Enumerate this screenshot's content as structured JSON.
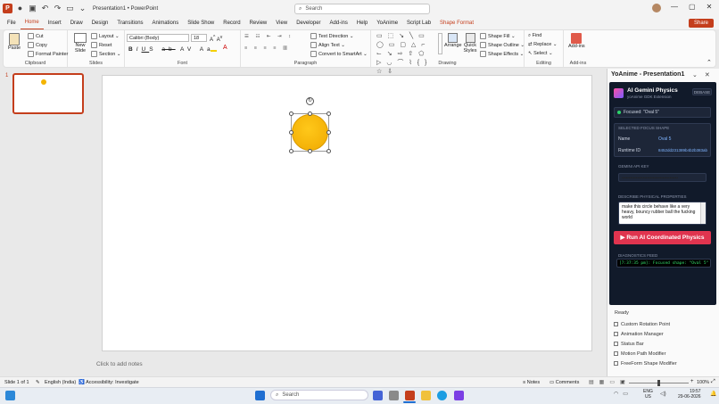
{
  "app": {
    "title": "Presentation1  •  PowerPoint",
    "search_placeholder": "Search",
    "share_label": "Share"
  },
  "tabs": [
    "File",
    "Home",
    "Insert",
    "Draw",
    "Design",
    "Transitions",
    "Animations",
    "Slide Show",
    "Record",
    "Review",
    "View",
    "Developer",
    "Add-ins",
    "Help",
    "YoAnime",
    "Script Lab",
    "Shape Format"
  ],
  "ribbon": {
    "clipboard": {
      "label": "Clipboard",
      "paste": "Paste",
      "cut": "Cut",
      "copy": "Copy",
      "format_painter": "Format Painter"
    },
    "slides": {
      "label": "Slides",
      "new_slide": "New Slide",
      "layout": "Layout",
      "reset": "Reset",
      "section": "Section"
    },
    "font": {
      "label": "Font",
      "font_name": "Calibri (Body)",
      "font_size": "18"
    },
    "paragraph": {
      "label": "Paragraph",
      "text_direction": "Text Direction",
      "align_text": "Align Text",
      "convert_smartart": "Convert to SmartArt"
    },
    "drawing": {
      "label": "Drawing",
      "arrange": "Arrange",
      "quick_styles": "Quick Styles",
      "shape_fill": "Shape Fill",
      "shape_outline": "Shape Outline",
      "shape_effects": "Shape Effects"
    },
    "editing": {
      "label": "Editing",
      "find": "Find",
      "replace": "Replace",
      "select": "Select"
    },
    "addins": {
      "label": "Add-ins",
      "addins_btn": "Add-ins"
    }
  },
  "slides": {
    "thumb_number": "1"
  },
  "notes_placeholder": "Click to add notes",
  "taskpane": {
    "title": "YoAnime - Presentation1",
    "header": {
      "name": "AI Gemini Physics",
      "subtitle": "yoAnime GDK Extension",
      "badge": "DEBASE"
    },
    "focused": "Focused: \"Oval 5\"",
    "section_shape": "SELECTED FOCUS SHAPE",
    "name_label": "Name",
    "name_value": "Oval 5",
    "runtime_label": "Runtime ID",
    "runtime_value": "8452dd231389b4b2b383ab",
    "api_label": "GEMINI API KEY",
    "api_value": "••••••••••••••••••••••••••••••••••••••••",
    "prompt_label": "DESCRIBE PHYSICAL PROPERTIES",
    "prompt_value": "make this circle behave like a very heavy, bouncy rubber ball the fucking world",
    "run_button": "▶ Run AI Coordinated Physics",
    "diag_label": "DIAGNOSTICS FEED",
    "diag_value": "[7:37:35 pm]: Focused shape: \"Oval 5\"",
    "ready": "Ready",
    "options": [
      "Custom Rotation Point",
      "Animation Manager",
      "Status Bar",
      "Motion Path Modifier",
      "FreeForm Shape Modifier"
    ]
  },
  "status": {
    "slide": "Slide 1 of 1",
    "language": "English (India)",
    "accessibility": "Accessibility: Investigate",
    "notes": "Notes",
    "comments": "Comments",
    "zoom": "100%"
  },
  "taskbar": {
    "search": "Search",
    "lang": "ENG",
    "region": "US",
    "time": "19:57",
    "date": "29-06-2026"
  },
  "colors": {
    "accent": "#c43e1c",
    "shape": "#f4b400",
    "pane_dark": "#111a2a",
    "run": "#e0344f"
  }
}
